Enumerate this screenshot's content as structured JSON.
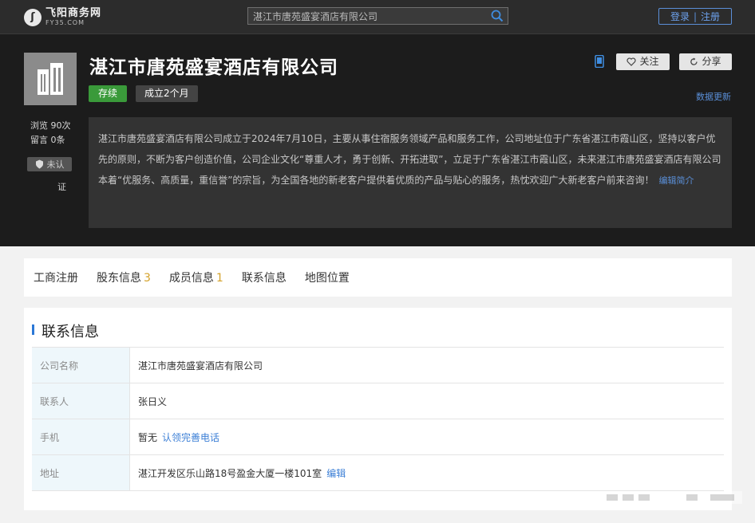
{
  "site": {
    "logo_name": "飞阳商务网",
    "logo_sub": "FY35.COM",
    "search_value": "湛江市唐苑盛宴酒店有限公司",
    "login": "登录",
    "register": "注册"
  },
  "company": {
    "name": "湛江市唐苑盛宴酒店有限公司",
    "status": "存续",
    "age": "成立2个月",
    "follow": "关注",
    "share": "分享",
    "data_update": "数据更新",
    "views": "浏览 90次",
    "messages": "留言 0条",
    "unverified": "未认",
    "verified_suffix": "证",
    "intro": "湛江市唐苑盛宴酒店有限公司成立于2024年7月10日，主要从事住宿服务领域产品和服务工作，公司地址位于广东省湛江市霞山区，坚持以客户优先的原则，不断为客户创造价值，公司企业文化“尊重人才，勇于创新、开拓进取”，立足于广东省湛江市霞山区，未来湛江市唐苑盛宴酒店有限公司本着“优服务、高质量，重信誉”的宗旨，为全国各地的新老客户提供着优质的产品与贴心的服务，热忱欢迎广大新老客户前来咨询！",
    "intro_edit": "编辑简介"
  },
  "tabs": [
    {
      "label": "工商注册",
      "count": ""
    },
    {
      "label": "股东信息",
      "count": "3"
    },
    {
      "label": "成员信息",
      "count": "1"
    },
    {
      "label": "联系信息",
      "count": ""
    },
    {
      "label": "地图位置",
      "count": ""
    }
  ],
  "contact": {
    "title": "联系信息",
    "rows": [
      {
        "label": "公司名称",
        "value": "湛江市唐苑盛宴酒店有限公司",
        "link": ""
      },
      {
        "label": "联系人",
        "value": "张日义",
        "link": ""
      },
      {
        "label": "手机",
        "value": "暂无",
        "link": "认领完善电话"
      },
      {
        "label": "地址",
        "value": "湛江开发区乐山路18号盈金大厦一楼101室",
        "link": "编辑"
      }
    ]
  },
  "colors": {
    "accent": "#2b78d6",
    "status_green": "#3a9a3a",
    "header_bg": "#1c1c1c",
    "count_gold": "#d4a22a"
  },
  "icons": [
    "logo-mark-icon",
    "search-icon",
    "building-icon",
    "phone-icon",
    "heart-icon",
    "share-icon",
    "shield-icon"
  ]
}
